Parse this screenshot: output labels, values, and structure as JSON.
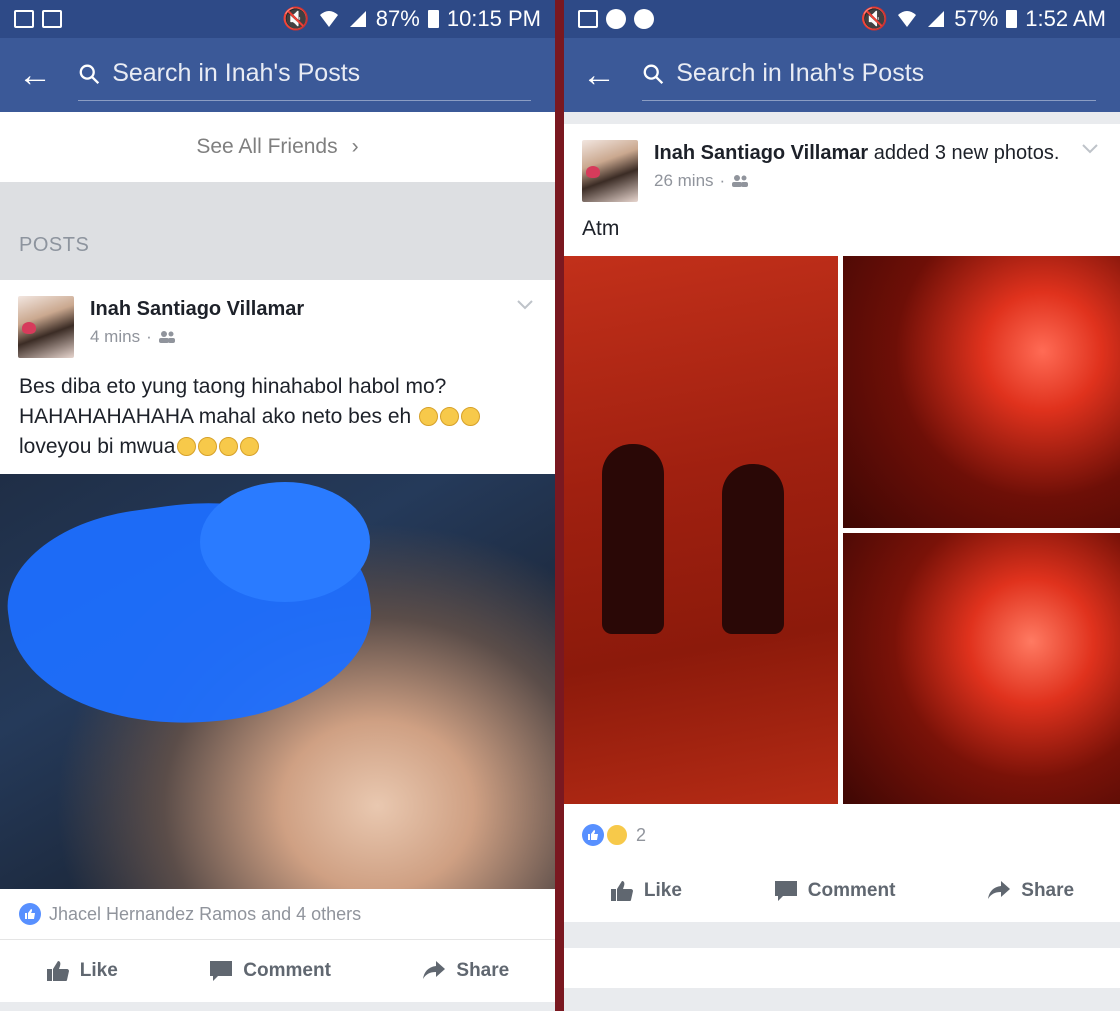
{
  "left": {
    "status": {
      "battery": "87%",
      "time": "10:15 PM"
    },
    "search": {
      "placeholder": "Search in Inah's Posts"
    },
    "see_all": {
      "label": "See All Friends",
      "chevron": "›"
    },
    "posts_header": "POSTS",
    "post": {
      "author": "Inah Santiago Villamar",
      "time": "4 mins",
      "separator": "·",
      "text_line1": "Bes diba eto yung taong hinahabol habol mo?",
      "text_line2": "HAHAHAHAHAHA mahal ako neto bes eh",
      "text_line3": "loveyou bi mwua",
      "reactions": "Jhacel Hernandez Ramos and 4 others"
    },
    "actions": {
      "like": "Like",
      "comment": "Comment",
      "share": "Share"
    }
  },
  "right": {
    "status": {
      "battery": "57%",
      "time": "1:52 AM"
    },
    "search": {
      "placeholder": "Search in Inah's Posts"
    },
    "post": {
      "author": "Inah Santiago Villamar",
      "action": "added 3 new photos.",
      "time": "26 mins",
      "separator": "·",
      "text": "Atm",
      "reaction_count": "2"
    },
    "actions": {
      "like": "Like",
      "comment": "Comment",
      "share": "Share"
    }
  },
  "colors": {
    "status_bar": "#2e4a87",
    "nav_bar": "#3b5998",
    "like_blue": "#5890ff",
    "divider": "#7a1820"
  },
  "icons": [
    "back-arrow-icon",
    "search-icon",
    "chevron-right-icon",
    "friends-icon",
    "chevron-down-icon",
    "like-icon",
    "comment-icon",
    "share-icon",
    "haha-icon",
    "wifi-icon",
    "signal-icon",
    "battery-icon",
    "mute-icon",
    "messenger-icon"
  ]
}
